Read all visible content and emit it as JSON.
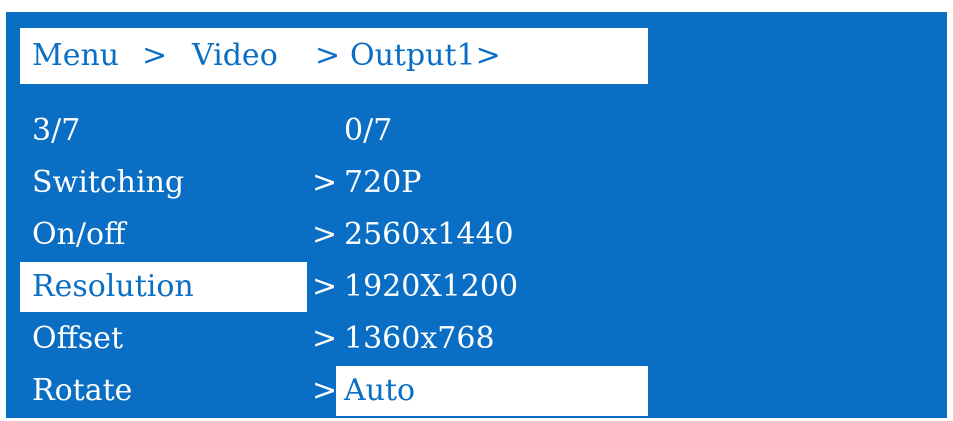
{
  "breadcrumb": {
    "menu": "Menu",
    "sep1": ">",
    "video": "Video",
    "sep2": ">",
    "output": "Output1>"
  },
  "left_panel": {
    "counter": "3/7",
    "items": [
      {
        "label": "Switching",
        "chevron": ">"
      },
      {
        "label": "On/off",
        "chevron": ">"
      },
      {
        "label": "Resolution",
        "chevron": ">"
      },
      {
        "label": "Offset",
        "chevron": ">"
      },
      {
        "label": "Rotate",
        "chevron": ">"
      }
    ],
    "selected_index": 2
  },
  "right_panel": {
    "counter": "0/7",
    "options": [
      "720P",
      "2560x1440",
      "1920X1200",
      "1360x768",
      "Auto"
    ],
    "selected_index": 4
  },
  "colors": {
    "background": "#0a6fc4",
    "highlight": "#ffffff",
    "text": "#ffffff"
  }
}
